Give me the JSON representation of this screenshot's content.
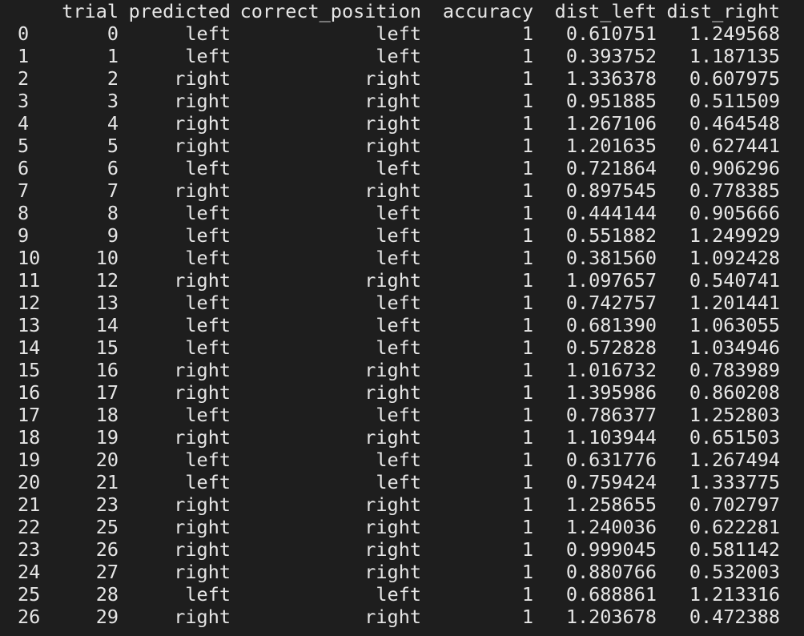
{
  "table": {
    "columns": [
      "trial",
      "predicted",
      "correct_position",
      "accuracy",
      "dist_left",
      "dist_right"
    ],
    "rows": [
      {
        "index": "0",
        "trial": "0",
        "predicted": "left",
        "correct_position": "left",
        "accuracy": "1",
        "dist_left": "0.610751",
        "dist_right": "1.249568"
      },
      {
        "index": "1",
        "trial": "1",
        "predicted": "left",
        "correct_position": "left",
        "accuracy": "1",
        "dist_left": "0.393752",
        "dist_right": "1.187135"
      },
      {
        "index": "2",
        "trial": "2",
        "predicted": "right",
        "correct_position": "right",
        "accuracy": "1",
        "dist_left": "1.336378",
        "dist_right": "0.607975"
      },
      {
        "index": "3",
        "trial": "3",
        "predicted": "right",
        "correct_position": "right",
        "accuracy": "1",
        "dist_left": "0.951885",
        "dist_right": "0.511509"
      },
      {
        "index": "4",
        "trial": "4",
        "predicted": "right",
        "correct_position": "right",
        "accuracy": "1",
        "dist_left": "1.267106",
        "dist_right": "0.464548"
      },
      {
        "index": "5",
        "trial": "5",
        "predicted": "right",
        "correct_position": "right",
        "accuracy": "1",
        "dist_left": "1.201635",
        "dist_right": "0.627441"
      },
      {
        "index": "6",
        "trial": "6",
        "predicted": "left",
        "correct_position": "left",
        "accuracy": "1",
        "dist_left": "0.721864",
        "dist_right": "0.906296"
      },
      {
        "index": "7",
        "trial": "7",
        "predicted": "right",
        "correct_position": "right",
        "accuracy": "1",
        "dist_left": "0.897545",
        "dist_right": "0.778385"
      },
      {
        "index": "8",
        "trial": "8",
        "predicted": "left",
        "correct_position": "left",
        "accuracy": "1",
        "dist_left": "0.444144",
        "dist_right": "0.905666"
      },
      {
        "index": "9",
        "trial": "9",
        "predicted": "left",
        "correct_position": "left",
        "accuracy": "1",
        "dist_left": "0.551882",
        "dist_right": "1.249929"
      },
      {
        "index": "10",
        "trial": "10",
        "predicted": "left",
        "correct_position": "left",
        "accuracy": "1",
        "dist_left": "0.381560",
        "dist_right": "1.092428"
      },
      {
        "index": "11",
        "trial": "12",
        "predicted": "right",
        "correct_position": "right",
        "accuracy": "1",
        "dist_left": "1.097657",
        "dist_right": "0.540741"
      },
      {
        "index": "12",
        "trial": "13",
        "predicted": "left",
        "correct_position": "left",
        "accuracy": "1",
        "dist_left": "0.742757",
        "dist_right": "1.201441"
      },
      {
        "index": "13",
        "trial": "14",
        "predicted": "left",
        "correct_position": "left",
        "accuracy": "1",
        "dist_left": "0.681390",
        "dist_right": "1.063055"
      },
      {
        "index": "14",
        "trial": "15",
        "predicted": "left",
        "correct_position": "left",
        "accuracy": "1",
        "dist_left": "0.572828",
        "dist_right": "1.034946"
      },
      {
        "index": "15",
        "trial": "16",
        "predicted": "right",
        "correct_position": "right",
        "accuracy": "1",
        "dist_left": "1.016732",
        "dist_right": "0.783989"
      },
      {
        "index": "16",
        "trial": "17",
        "predicted": "right",
        "correct_position": "right",
        "accuracy": "1",
        "dist_left": "1.395986",
        "dist_right": "0.860208"
      },
      {
        "index": "17",
        "trial": "18",
        "predicted": "left",
        "correct_position": "left",
        "accuracy": "1",
        "dist_left": "0.786377",
        "dist_right": "1.252803"
      },
      {
        "index": "18",
        "trial": "19",
        "predicted": "right",
        "correct_position": "right",
        "accuracy": "1",
        "dist_left": "1.103944",
        "dist_right": "0.651503"
      },
      {
        "index": "19",
        "trial": "20",
        "predicted": "left",
        "correct_position": "left",
        "accuracy": "1",
        "dist_left": "0.631776",
        "dist_right": "1.267494"
      },
      {
        "index": "20",
        "trial": "21",
        "predicted": "left",
        "correct_position": "left",
        "accuracy": "1",
        "dist_left": "0.759424",
        "dist_right": "1.333775"
      },
      {
        "index": "21",
        "trial": "23",
        "predicted": "right",
        "correct_position": "right",
        "accuracy": "1",
        "dist_left": "1.258655",
        "dist_right": "0.702797"
      },
      {
        "index": "22",
        "trial": "25",
        "predicted": "right",
        "correct_position": "right",
        "accuracy": "1",
        "dist_left": "1.240036",
        "dist_right": "0.622281"
      },
      {
        "index": "23",
        "trial": "26",
        "predicted": "right",
        "correct_position": "right",
        "accuracy": "1",
        "dist_left": "0.999045",
        "dist_right": "0.581142"
      },
      {
        "index": "24",
        "trial": "27",
        "predicted": "right",
        "correct_position": "right",
        "accuracy": "1",
        "dist_left": "0.880766",
        "dist_right": "0.532003"
      },
      {
        "index": "25",
        "trial": "28",
        "predicted": "left",
        "correct_position": "left",
        "accuracy": "1",
        "dist_left": "0.688861",
        "dist_right": "1.213316"
      },
      {
        "index": "26",
        "trial": "29",
        "predicted": "right",
        "correct_position": "right",
        "accuracy": "1",
        "dist_left": "1.203678",
        "dist_right": "0.472388"
      }
    ]
  }
}
